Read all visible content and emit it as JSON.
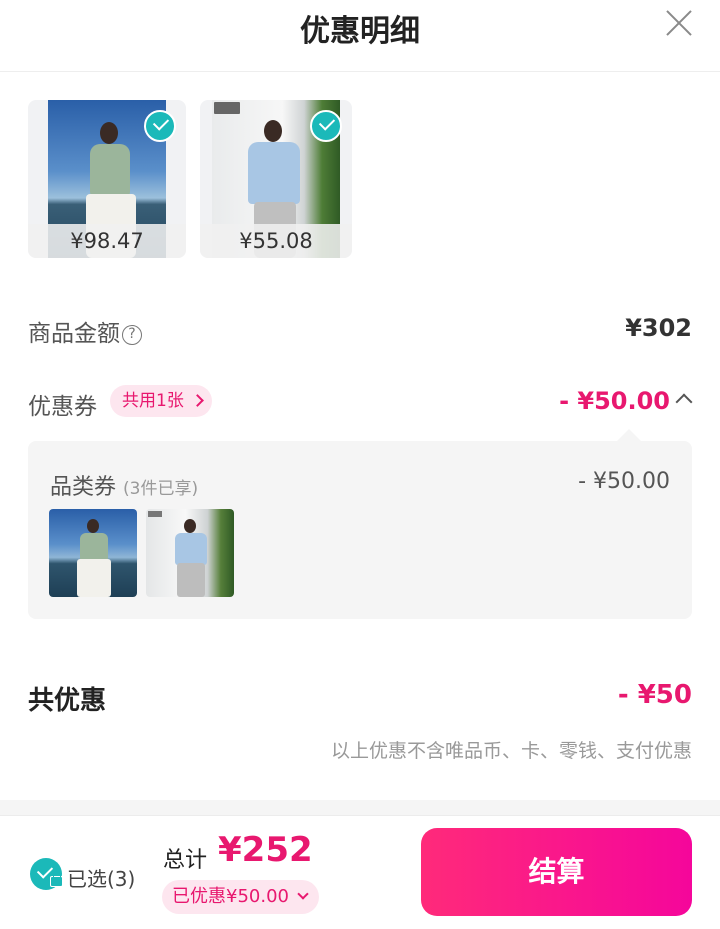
{
  "header": {
    "title": "优惠明细",
    "close_icon": "close-icon"
  },
  "products": [
    {
      "price": "¥98.47",
      "selected": true
    },
    {
      "price": "¥55.08",
      "selected": true
    }
  ],
  "goods_amount": {
    "label": "商品金额",
    "help_icon": "?",
    "value": "¥302"
  },
  "coupon": {
    "label": "优惠券",
    "shared_badge": "共用1张",
    "value": "- ¥50.00",
    "detail": {
      "category_label": "品类券",
      "category_sub": "(3件已享)",
      "category_amount": "- ¥50.00"
    }
  },
  "total_discount": {
    "label": "共优惠",
    "value": "- ¥50",
    "note": "以上优惠不含唯品币、卡、零钱、支付优惠"
  },
  "bottom_bar": {
    "selected_label": "已选(3)",
    "total_label": "总计",
    "total_value": "¥252",
    "saved_label": "已优惠¥50.00",
    "checkout_label": "结算"
  },
  "colors": {
    "accent": "#e8186f",
    "check": "#1bb9b9",
    "panel_bg": "#f5f5f5"
  }
}
